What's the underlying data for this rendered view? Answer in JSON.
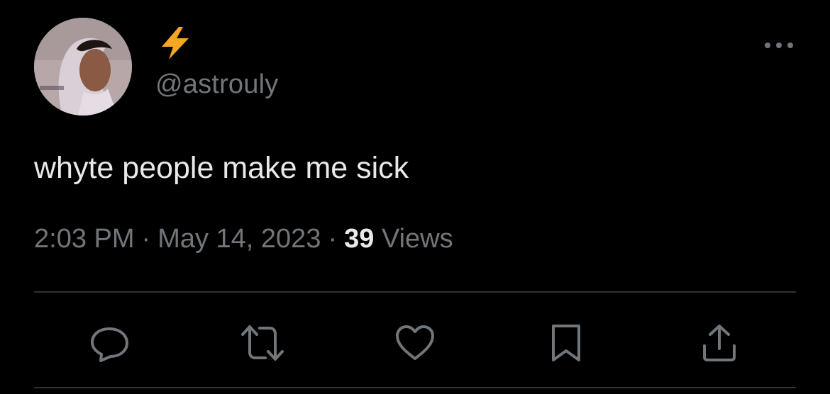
{
  "author": {
    "display_name_icon": "lightning-bolt-emoji",
    "handle": "@astrouly",
    "avatar_icon": "profile-photo"
  },
  "tweet": {
    "text": "whyte people make me sick",
    "time": "2:03 PM",
    "date": "May 14, 2023",
    "separator": "·",
    "views_count": "39",
    "views_label": "Views"
  },
  "actions": [
    {
      "name": "reply",
      "icon": "reply-icon"
    },
    {
      "name": "retweet",
      "icon": "retweet-icon"
    },
    {
      "name": "like",
      "icon": "heart-icon"
    },
    {
      "name": "bookmark",
      "icon": "bookmark-icon"
    },
    {
      "name": "share",
      "icon": "share-icon"
    }
  ],
  "colors": {
    "background": "#000000",
    "primary_text": "#e7e9ea",
    "secondary_text": "#71767b",
    "divider": "#2f3336",
    "bolt": "#f5a623"
  }
}
